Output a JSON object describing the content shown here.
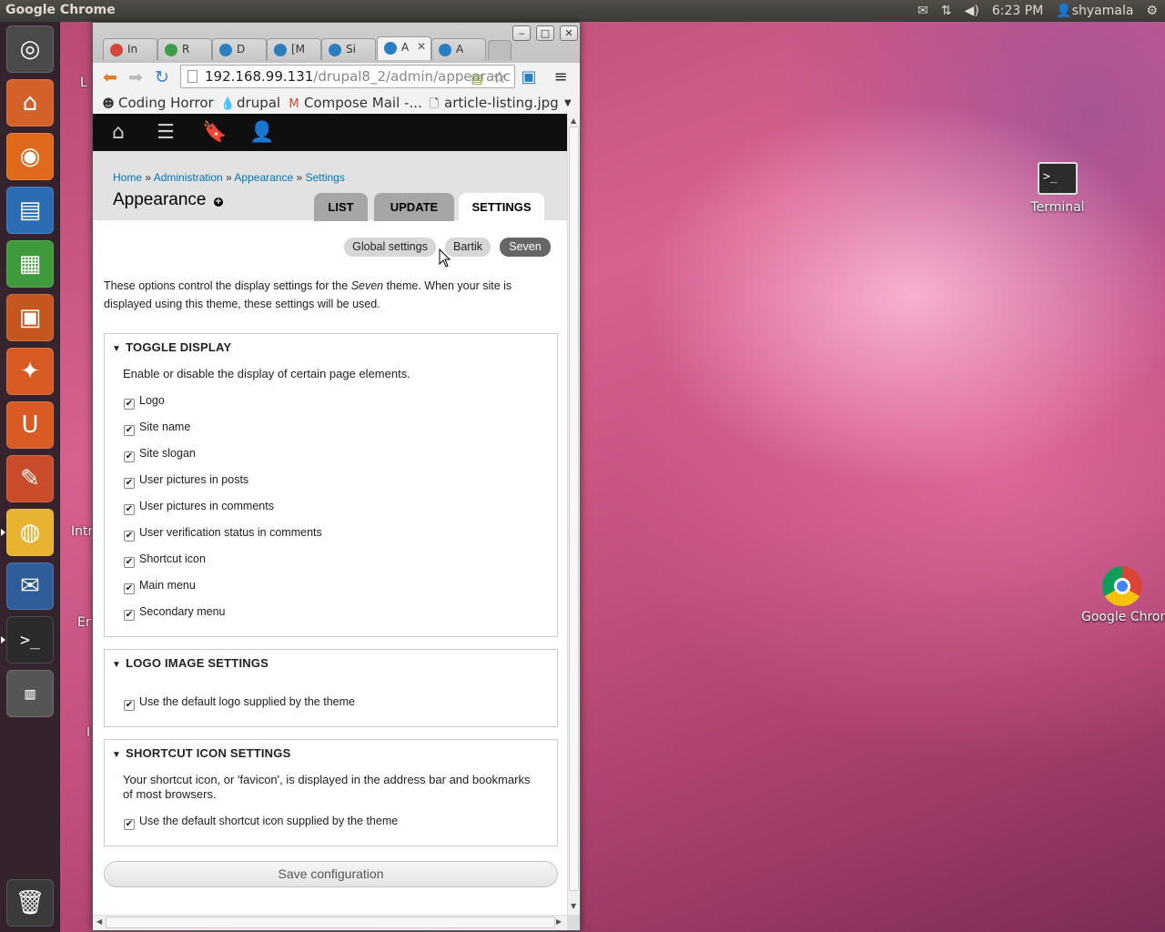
{
  "top_panel": {
    "app_title": "Google Chrome",
    "time": "6:23 PM",
    "user": "shyamala",
    "icons": [
      "mail-icon",
      "network-icon",
      "volume-icon",
      "user-icon",
      "power-gear-icon"
    ]
  },
  "launcher": {
    "items": [
      {
        "name": "dash-icon",
        "glyph": "◎",
        "color": "#4a4a4a"
      },
      {
        "name": "files-icon",
        "glyph": "⌂",
        "color": "#d4602a"
      },
      {
        "name": "firefox-icon",
        "glyph": "◉",
        "color": "#e06a1c"
      },
      {
        "name": "writer-icon",
        "glyph": "▤",
        "color": "#2b6cb2"
      },
      {
        "name": "calc-icon",
        "glyph": "▦",
        "color": "#3e9a3a"
      },
      {
        "name": "impress-icon",
        "glyph": "▣",
        "color": "#c6561f"
      },
      {
        "name": "software-center-icon",
        "glyph": "✦",
        "color": "#d85a24"
      },
      {
        "name": "ubuntu-one-icon",
        "glyph": "U",
        "color": "#d85b24"
      },
      {
        "name": "settings-icon",
        "glyph": "✎",
        "color": "#c94d2a"
      },
      {
        "name": "chrome-icon",
        "glyph": "◍",
        "color": "#e8b330"
      },
      {
        "name": "thunderbird-icon",
        "glyph": "✉",
        "color": "#2e5d9a"
      },
      {
        "name": "terminal-icon",
        "glyph": ">_",
        "color": "#2b2b2b"
      },
      {
        "name": "workspace-switcher-icon",
        "glyph": "▥",
        "color": "#555555"
      }
    ],
    "trash": {
      "name": "trash-icon",
      "glyph": "🗑"
    }
  },
  "desktop": {
    "peek_labels": [
      "L",
      "Intr",
      "Er",
      "I"
    ],
    "icons": [
      {
        "label": "Terminal"
      },
      {
        "label": "Google Chrom"
      }
    ]
  },
  "browser": {
    "tabs": [
      {
        "label": "In",
        "favicon": "gmail-icon",
        "color": "#d44638"
      },
      {
        "label": "R",
        "favicon": "drive-icon",
        "color": "#3a9e4b"
      },
      {
        "label": "D",
        "favicon": "drupal-icon",
        "color": "#2a7fc0"
      },
      {
        "label": "[M",
        "favicon": "drupal-icon",
        "color": "#2a7fc0"
      },
      {
        "label": "Si",
        "favicon": "drupal-icon",
        "color": "#2a7fc0"
      },
      {
        "label": "A",
        "favicon": "drupal-icon",
        "color": "#2a7fc0",
        "active": true
      },
      {
        "label": "A",
        "favicon": "drupal-icon",
        "color": "#2a7fc0"
      }
    ],
    "url_host": "192.168.99.131",
    "url_path": "/drupal8_2/admin/appearanc",
    "bookmarks": [
      {
        "label": "Coding Horror",
        "icon": "coding-horror-icon"
      },
      {
        "label": "drupal",
        "icon": "drupal-icon"
      },
      {
        "label": "Compose Mail -...",
        "icon": "gmail-icon"
      },
      {
        "label": "article-listing.jpg",
        "icon": "file-icon"
      }
    ]
  },
  "drupal": {
    "breadcrumb": [
      "Home",
      "Administration",
      "Appearance",
      "Settings"
    ],
    "page_title": "Appearance",
    "primary_tabs": [
      "LIST",
      "UPDATE",
      "SETTINGS"
    ],
    "active_primary_tab": "SETTINGS",
    "secondary_tabs": [
      "Global settings",
      "Bartik",
      "Seven"
    ],
    "active_secondary_tab": "Seven",
    "intro_before": "These options control the display settings for the ",
    "intro_theme": "Seven",
    "intro_after": " theme. When your site is displayed using this theme, these settings will be used.",
    "toggle_display": {
      "legend": "TOGGLE DISPLAY",
      "description": "Enable or disable the display of certain page elements.",
      "options": [
        {
          "label": "Logo",
          "checked": true
        },
        {
          "label": "Site name",
          "checked": true
        },
        {
          "label": "Site slogan",
          "checked": true
        },
        {
          "label": "User pictures in posts",
          "checked": true
        },
        {
          "label": "User pictures in comments",
          "checked": true
        },
        {
          "label": "User verification status in comments",
          "checked": true
        },
        {
          "label": "Shortcut icon",
          "checked": true
        },
        {
          "label": "Main menu",
          "checked": true
        },
        {
          "label": "Secondary menu",
          "checked": true
        }
      ]
    },
    "logo_settings": {
      "legend": "LOGO IMAGE SETTINGS",
      "option": "Use the default logo supplied by the theme"
    },
    "shortcut_settings": {
      "legend": "SHORTCUT ICON SETTINGS",
      "description": "Your shortcut icon, or 'favicon', is displayed in the address bar and bookmarks of most browsers.",
      "option": "Use the default shortcut icon supplied by the theme"
    },
    "save_label": "Save configuration"
  }
}
